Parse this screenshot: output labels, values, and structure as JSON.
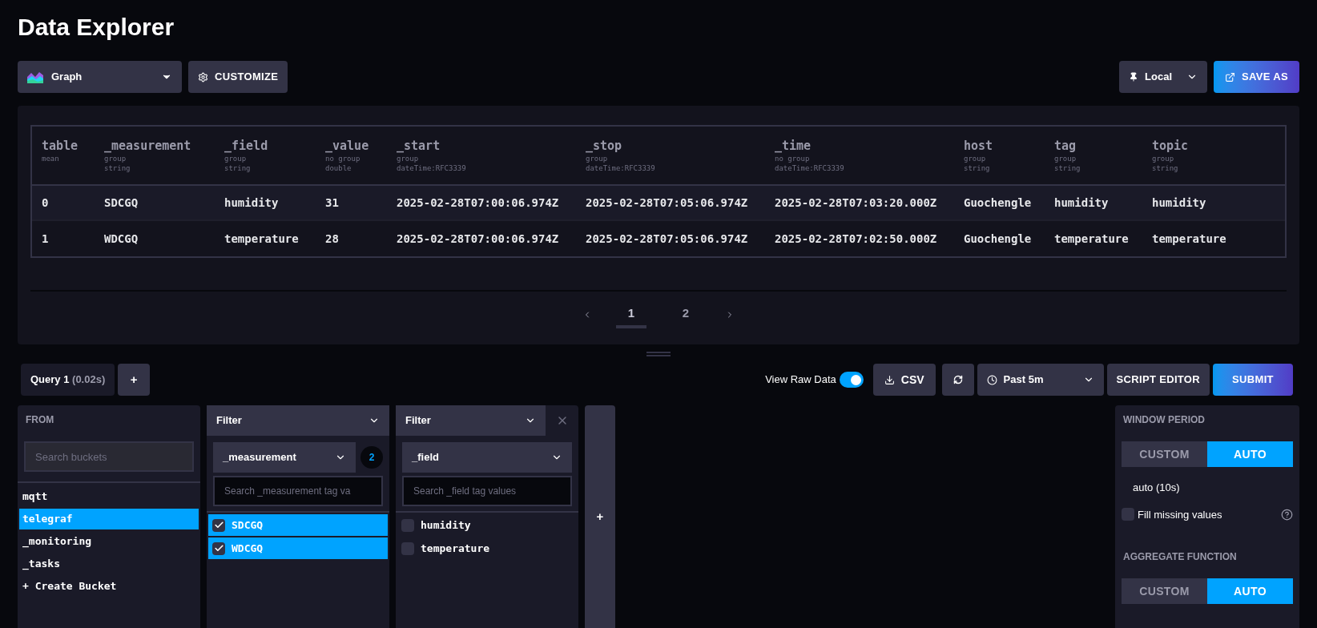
{
  "page_title": "Data Explorer",
  "toolbar": {
    "visualization": "Graph",
    "customize": "CUSTOMIZE",
    "location": "Local",
    "save_as": "SAVE AS"
  },
  "table": {
    "columns": [
      {
        "name": "table",
        "meta": [
          "mean"
        ]
      },
      {
        "name": "_measurement",
        "meta": [
          "group",
          "string"
        ]
      },
      {
        "name": "_field",
        "meta": [
          "group",
          "string"
        ]
      },
      {
        "name": "_value",
        "meta": [
          "no group",
          "double"
        ]
      },
      {
        "name": "_start",
        "meta": [
          "group",
          "dateTime:RFC3339"
        ]
      },
      {
        "name": "_stop",
        "meta": [
          "group",
          "dateTime:RFC3339"
        ]
      },
      {
        "name": "_time",
        "meta": [
          "no group",
          "dateTime:RFC3339"
        ]
      },
      {
        "name": "host",
        "meta": [
          "group",
          "string"
        ]
      },
      {
        "name": "tag",
        "meta": [
          "group",
          "string"
        ]
      },
      {
        "name": "topic",
        "meta": [
          "group",
          "string"
        ]
      }
    ],
    "rows": [
      [
        "0",
        "SDCGQ",
        "humidity",
        "31",
        "2025-02-28T07:00:06.974Z",
        "2025-02-28T07:05:06.974Z",
        "2025-02-28T07:03:20.000Z",
        "Guochengle",
        "humidity",
        "humidity"
      ],
      [
        "1",
        "WDCGQ",
        "temperature",
        "28",
        "2025-02-28T07:00:06.974Z",
        "2025-02-28T07:05:06.974Z",
        "2025-02-28T07:02:50.000Z",
        "Guochengle",
        "temperature",
        "temperature"
      ]
    ]
  },
  "pagination": {
    "pages": [
      {
        "label": "1",
        "selected": true
      },
      {
        "label": "2",
        "selected": false
      }
    ]
  },
  "query_tabs": [
    {
      "label": "Query 1",
      "timing": "(0.02s)",
      "selected": true
    }
  ],
  "add_query": "+",
  "query_actions": {
    "view_raw": {
      "label": "View Raw Data",
      "on": true
    },
    "csv": "CSV",
    "time_range": "Past 5m",
    "script_editor": "SCRIPT EDITOR",
    "submit": "SUBMIT"
  },
  "from": {
    "title": "FROM",
    "placeholder": "Search buckets",
    "buckets": [
      {
        "name": "mqtt",
        "selected": false
      },
      {
        "name": "telegraf",
        "selected": true
      },
      {
        "name": "_monitoring",
        "selected": false
      },
      {
        "name": "_tasks",
        "selected": false
      }
    ],
    "create": "+ Create Bucket"
  },
  "filters": [
    {
      "function": "Filter",
      "key": "_measurement",
      "count": "2",
      "placeholder": "Search _measurement tag va",
      "removable": false,
      "values": [
        {
          "label": "SDCGQ",
          "checked": true
        },
        {
          "label": "WDCGQ",
          "checked": true
        }
      ]
    },
    {
      "function": "Filter",
      "key": "_field",
      "placeholder": "Search _field tag values",
      "removable": true,
      "values": [
        {
          "label": "humidity",
          "checked": false
        },
        {
          "label": "temperature",
          "checked": false
        }
      ]
    }
  ],
  "add_filter": "+",
  "options": {
    "window_period": {
      "title": "WINDOW PERIOD",
      "options": [
        {
          "label": "CUSTOM",
          "selected": false
        },
        {
          "label": "AUTO",
          "selected": true
        }
      ],
      "value": "auto (10s)",
      "fill_missing": {
        "label": "Fill missing values",
        "checked": false
      }
    },
    "aggregate": {
      "title": "AGGREGATE FUNCTION",
      "options": [
        {
          "label": "CUSTOM",
          "selected": false
        },
        {
          "label": "AUTO",
          "selected": true
        }
      ]
    }
  }
}
